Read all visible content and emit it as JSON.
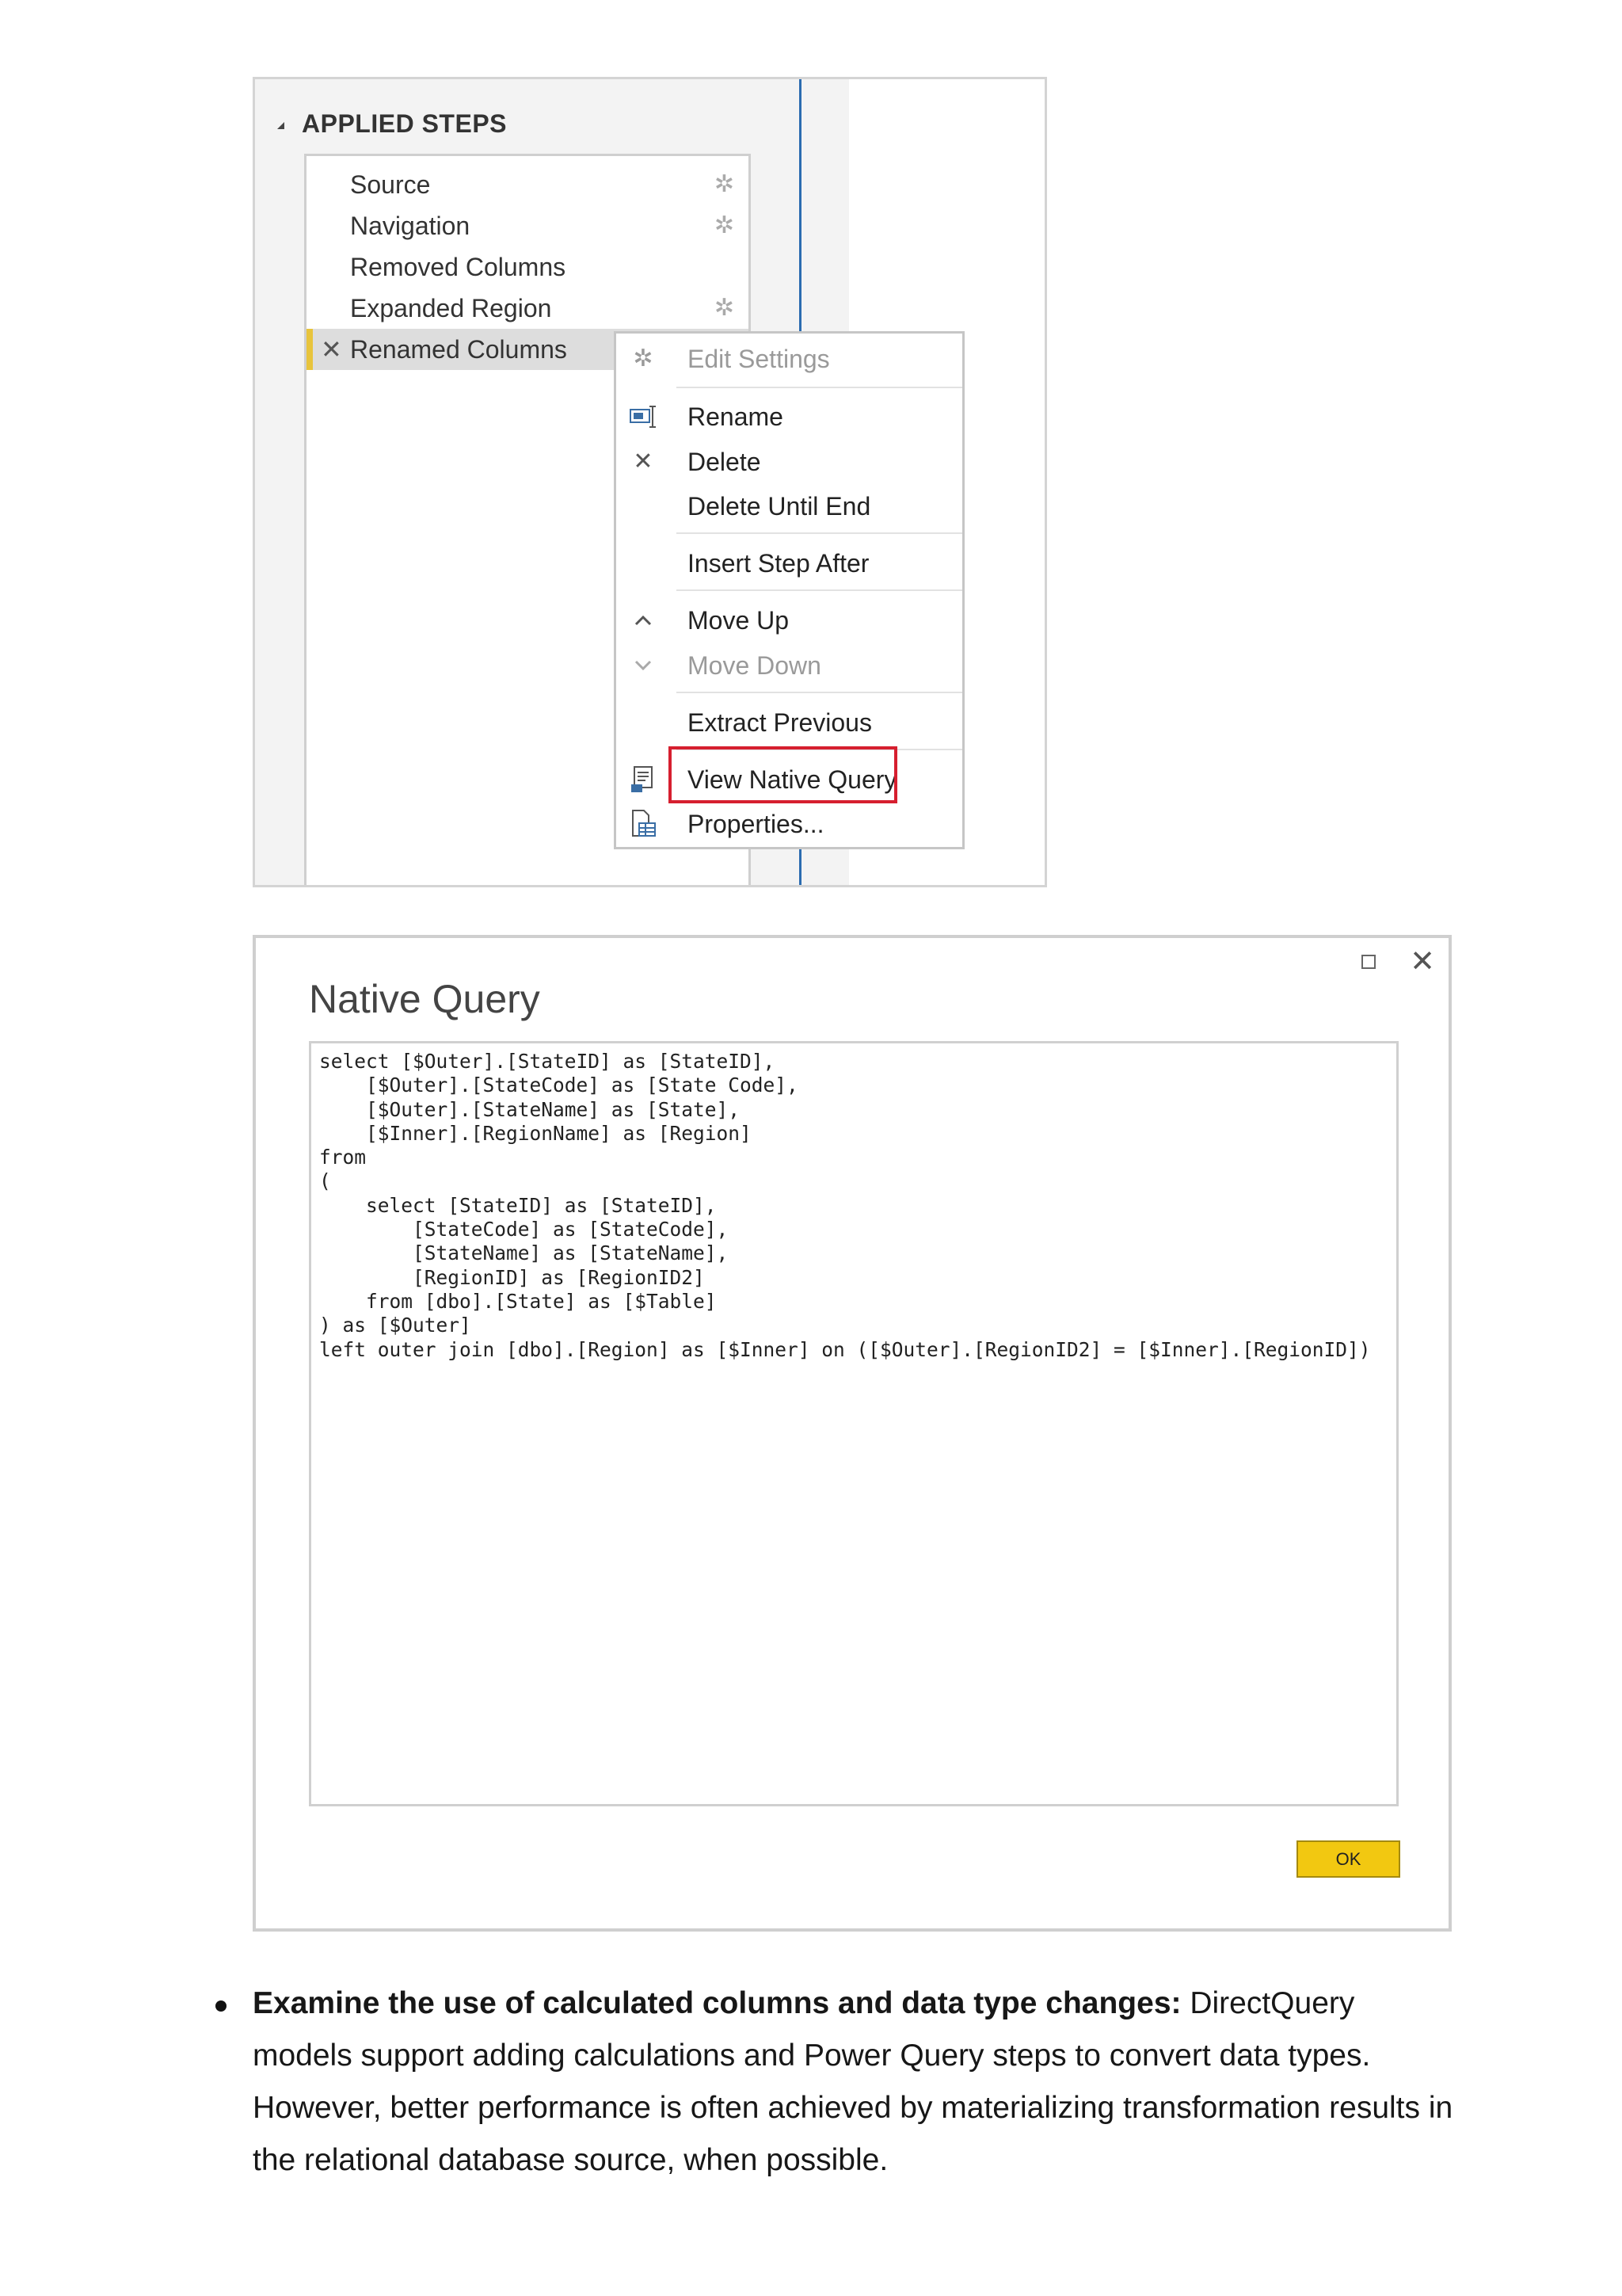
{
  "applied_steps": {
    "title": "APPLIED STEPS",
    "steps": [
      {
        "label": "Source",
        "has_gear": true
      },
      {
        "label": "Navigation",
        "has_gear": true
      },
      {
        "label": "Removed Columns",
        "has_gear": false
      },
      {
        "label": "Expanded Region",
        "has_gear": true
      },
      {
        "label": "Renamed Columns",
        "has_gear": false,
        "selected": true
      }
    ]
  },
  "context_menu": {
    "edit_settings": "Edit Settings",
    "rename": "Rename",
    "delete": "Delete",
    "delete_until_end": "Delete Until End",
    "insert_step_after": "Insert Step After",
    "move_up": "Move Up",
    "move_down": "Move Down",
    "extract_previous": "Extract Previous",
    "view_native_query": "View Native Query",
    "properties": "Properties..."
  },
  "native_query": {
    "title": "Native Query",
    "query": "select [$Outer].[StateID] as [StateID],\n    [$Outer].[StateCode] as [State Code],\n    [$Outer].[StateName] as [State],\n    [$Inner].[RegionName] as [Region]\nfrom\n(\n    select [StateID] as [StateID],\n        [StateCode] as [StateCode],\n        [StateName] as [StateName],\n        [RegionID] as [RegionID2]\n    from [dbo].[State] as [$Table]\n) as [$Outer]\nleft outer join [dbo].[Region] as [$Inner] on ([$Outer].[RegionID2] = [$Inner].[RegionID])",
    "ok_label": "OK"
  },
  "bullet": {
    "bold": "Examine the use of calculated columns and data type changes:",
    "text": " DirectQuery models support adding calculations and Power Query steps to convert data types. However, better performance is often achieved by materializing transformation results in the relational database source, when possible."
  },
  "colors": {
    "highlight_border": "#d61f2f",
    "ok_button": "#f2c811",
    "selected_step_marker": "#e8c43c"
  }
}
